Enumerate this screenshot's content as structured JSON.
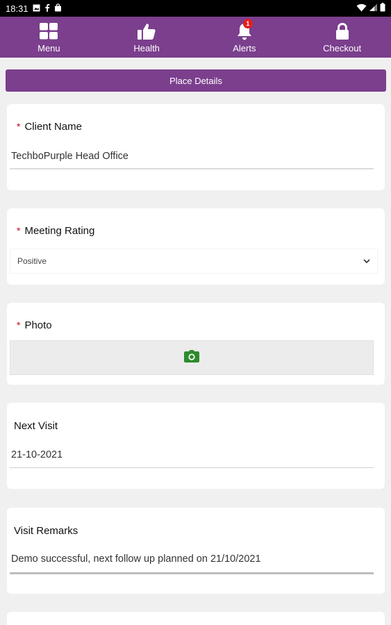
{
  "status_bar": {
    "time": "18:31"
  },
  "nav": {
    "items": [
      {
        "id": "menu",
        "label": "Menu",
        "icon": "grid-icon"
      },
      {
        "id": "health",
        "label": "Health",
        "icon": "thumbs-up-icon"
      },
      {
        "id": "alerts",
        "label": "Alerts",
        "icon": "bell-icon",
        "badge": "1"
      },
      {
        "id": "checkout",
        "label": "Checkout",
        "icon": "lock-icon"
      }
    ]
  },
  "section_title": "Place Details",
  "form": {
    "client_name": {
      "label": "Client Name",
      "required": "*",
      "value": "TechboPurple Head Office"
    },
    "meeting_rating": {
      "label": "Meeting Rating",
      "required": "*",
      "value": "Positive"
    },
    "photo": {
      "label": "Photo",
      "required": "*"
    },
    "next_visit": {
      "label": "Next Visit",
      "value": "21-10-2021"
    },
    "visit_remarks": {
      "label": "Visit Remarks",
      "value": "Demo successful, next follow up planned on 21/10/2021"
    }
  },
  "colors": {
    "brand": "#7b3f8d",
    "required": "#d0021b",
    "camera": "#2e8b2e",
    "badge": "#e02020"
  }
}
